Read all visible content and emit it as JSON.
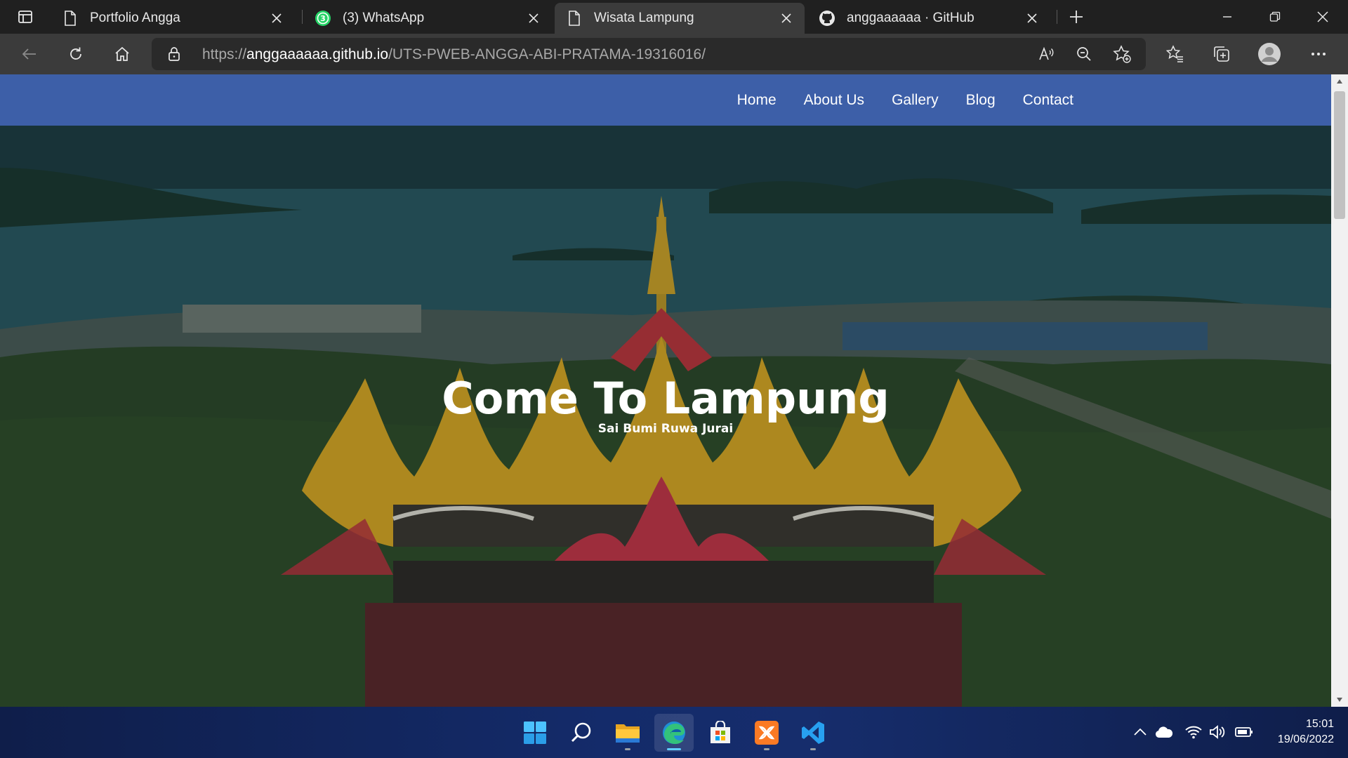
{
  "browser": {
    "tabs": [
      {
        "title": "Portfolio Angga",
        "icon": "page-icon",
        "active": false
      },
      {
        "title": "(3) WhatsApp",
        "icon": "whatsapp-icon",
        "badge": "3",
        "active": false
      },
      {
        "title": "Wisata Lampung",
        "icon": "page-icon",
        "active": true
      },
      {
        "title": "anggaaaaaa · GitHub",
        "icon": "github-icon",
        "active": false
      }
    ],
    "address": {
      "scheme": "https://",
      "host": "anggaaaaaa.github.io",
      "path": "/UTS-PWEB-ANGGA-ABI-PRATAMA-19316016/"
    }
  },
  "page": {
    "nav": [
      {
        "label": "Home"
      },
      {
        "label": "About Us"
      },
      {
        "label": "Gallery"
      },
      {
        "label": "Blog"
      },
      {
        "label": "Contact"
      }
    ],
    "hero": {
      "title": "Come To Lampung",
      "subtitle": "Sai Bumi Ruwa Jurai"
    }
  },
  "taskbar": {
    "apps": [
      "windows-start-icon",
      "search-icon",
      "file-explorer-icon",
      "edge-icon",
      "microsoft-store-icon",
      "xampp-icon",
      "vscode-icon"
    ],
    "tray": [
      "chevron-up-icon",
      "onedrive-cloud-icon",
      "wifi-icon",
      "volume-icon",
      "battery-icon"
    ],
    "time": "15:01",
    "date": "19/06/2022"
  },
  "colors": {
    "navbar": "#3d5fa8",
    "tab_active": "#3b3b3b",
    "tabstrip": "#202020"
  }
}
